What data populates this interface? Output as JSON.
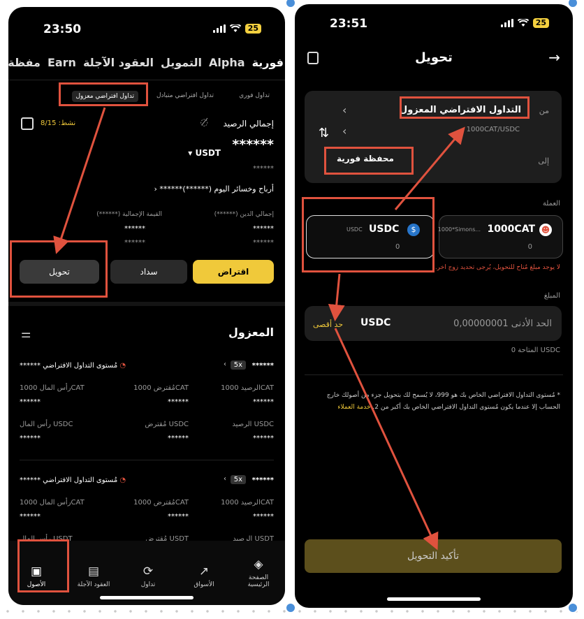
{
  "left": {
    "status": {
      "time": "23:50",
      "battery": "25"
    },
    "top_tabs": [
      "فورية",
      "Alpha",
      "التمويل",
      "العقود الآجلة",
      "Earn",
      "مفظة"
    ],
    "sub_tabs": [
      "تداول فوري",
      "تداول افتراضي متبادل",
      "تداول افتراضي معزول"
    ],
    "active_label": "نشط: 8/15",
    "balance_label": "إجمالي الرصيد",
    "balance_value": "******",
    "currency": "USDT",
    "balance_small": "******",
    "pnl_label": "أرباح وخسائر اليوم (******)******",
    "debt_label": "إجمالي الدين (******)",
    "total_label": "القيمة الإجمالية (******)",
    "debt_value": "******",
    "total_value": "******",
    "debt_sub": "******",
    "total_sub": "******",
    "buttons": {
      "borrow": "اقتراض",
      "repay": "سداد",
      "transfer": "تحويل"
    },
    "section_title": "المعزول",
    "positions": [
      {
        "name": "******",
        "leverage": "5x",
        "risk_label": "مُستوى التداول الافتراضي ******",
        "row1": {
          "balance_label": "الرصيد 1000CAT",
          "borrowed_label": "مُقترض 1000CAT",
          "capital_label": "رأس المال 1000CAT",
          "balance": "******",
          "borrowed": "******",
          "capital": "******"
        },
        "row2": {
          "balance_label": "الرصيد USDC",
          "borrowed_label": "مُقترض USDC",
          "capital_label": "رأس المال USDC",
          "balance": "******",
          "borrowed": "******",
          "capital": "******"
        }
      },
      {
        "name": "******",
        "leverage": "5x",
        "risk_label": "مُستوى التداول الافتراضي ******",
        "row1": {
          "balance_label": "الرصيد 1000CAT",
          "borrowed_label": "مُقترض 1000CAT",
          "capital_label": "رأس المال 1000CAT",
          "balance": "******",
          "borrowed": "******",
          "capital": "******"
        },
        "row2": {
          "balance_label": "الرصيد USDT",
          "borrowed_label": "مُقترض USDT",
          "capital_label": "رأس المال USDT"
        }
      }
    ],
    "nav": [
      "الصفحة الرئيسية",
      "الأسواق",
      "تداول",
      "العقود الآجلة",
      "الأصول"
    ]
  },
  "right": {
    "status": {
      "time": "23:51",
      "battery": "25"
    },
    "title": "تحويل",
    "from_label": "من",
    "from_value": "التداول الافتراضي المعزول",
    "pair": "1000CAT/USDC",
    "to_label": "إلى",
    "to_value": "محفظة فورية",
    "coin_section": "العملة",
    "coin_a": {
      "symbol": "1000CAT",
      "sub": "1000*Simons...",
      "amount": "0"
    },
    "coin_b": {
      "symbol": "USDC",
      "sub": "USDC",
      "amount": "0"
    },
    "warning": "لا يوجد مبلغ مُتاح للتحويل، يُرجى تحديد زوج آخر.",
    "amount_section": "المبلغ",
    "amount_placeholder": "الحد الأدنى 0,00000001",
    "amount_currency": "USDC",
    "max_label": "حد أقصى",
    "available": "المتاحة 0 USDC",
    "note": "* مُستوى التداول الافتراضي الخاص بك هو 999، لا يُسمح لك بتحويل جزء من أصولك خارج الحساب إلا عندما يكون مُستوى التداول الافتراضي الخاص بك أكبر من 2.",
    "note_link": "خدمة العملاء",
    "confirm": "تأكيد التحويل"
  },
  "colors": {
    "accent": "#f0c93a",
    "annotation": "#e0523e",
    "warning": "#e0523e"
  }
}
